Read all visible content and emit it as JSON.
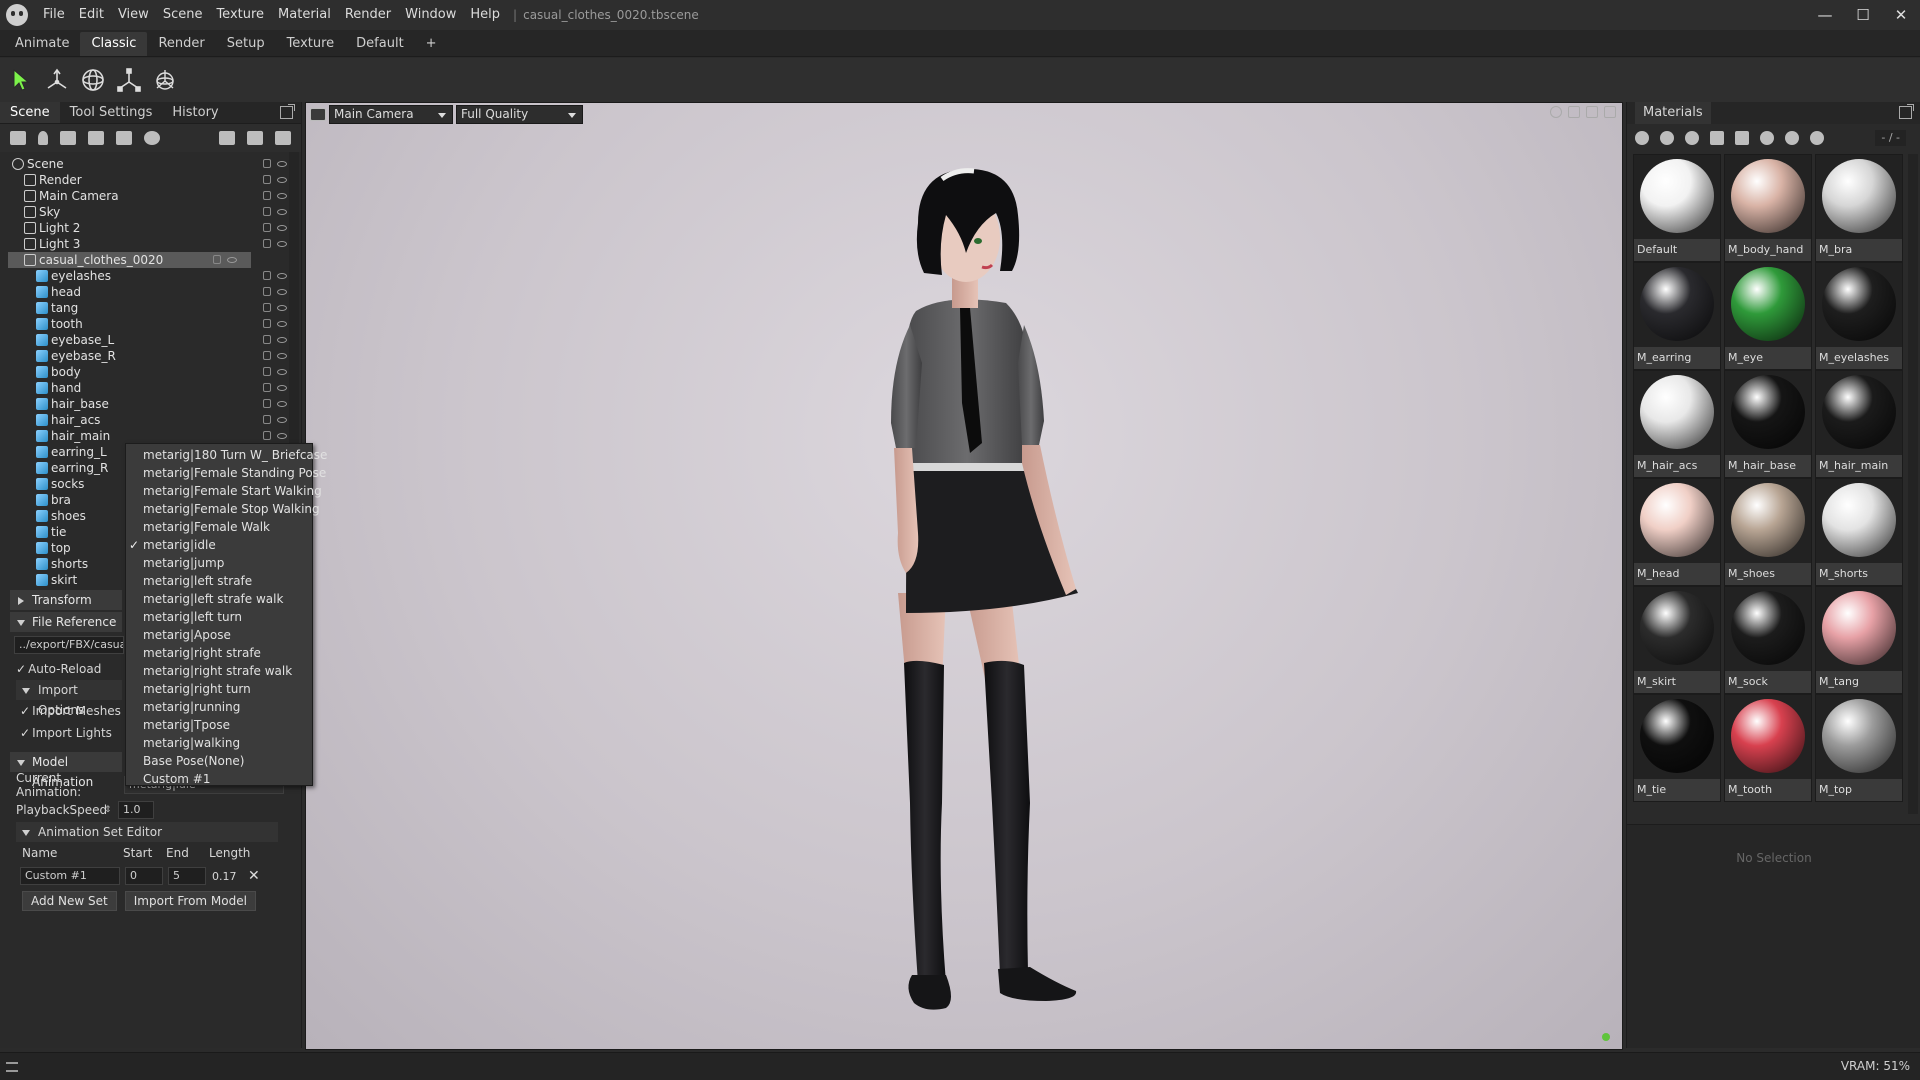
{
  "titlebar": {
    "menu": [
      "File",
      "Edit",
      "View",
      "Scene",
      "Texture",
      "Material",
      "Render",
      "Window",
      "Help"
    ],
    "document": "casual_clothes_0020.tbscene",
    "controls": [
      "—",
      "☐",
      "✕"
    ]
  },
  "workspace_tabs": [
    "Animate",
    "Classic",
    "Render",
    "Setup",
    "Texture",
    "Default",
    "+"
  ],
  "left_panel": {
    "tabs": [
      "Scene",
      "Tool Settings",
      "History"
    ],
    "tree": [
      {
        "label": "Scene",
        "level": 0
      },
      {
        "label": "Render",
        "level": 1
      },
      {
        "label": "Main Camera",
        "level": 1
      },
      {
        "label": "Sky",
        "level": 1
      },
      {
        "label": "Light 2",
        "level": 1
      },
      {
        "label": "Light 3",
        "level": 1
      },
      {
        "label": "casual_clothes_0020",
        "level": 1,
        "selected": true
      },
      {
        "label": "eyelashes",
        "level": 2
      },
      {
        "label": "head",
        "level": 2
      },
      {
        "label": "tang",
        "level": 2
      },
      {
        "label": "tooth",
        "level": 2
      },
      {
        "label": "eyebase_L",
        "level": 2
      },
      {
        "label": "eyebase_R",
        "level": 2
      },
      {
        "label": "body",
        "level": 2
      },
      {
        "label": "hand",
        "level": 2
      },
      {
        "label": "hair_base",
        "level": 2
      },
      {
        "label": "hair_acs",
        "level": 2
      },
      {
        "label": "hair_main",
        "level": 2
      },
      {
        "label": "earring_L",
        "level": 2
      },
      {
        "label": "earring_R",
        "level": 2
      },
      {
        "label": "socks",
        "level": 2
      },
      {
        "label": "bra",
        "level": 2
      },
      {
        "label": "shoes",
        "level": 2
      },
      {
        "label": "tie",
        "level": 2
      },
      {
        "label": "top",
        "level": 2
      },
      {
        "label": "shorts",
        "level": 2
      },
      {
        "label": "skirt",
        "level": 2
      }
    ],
    "transform_header": "Transform",
    "file_reference_header": "File Reference",
    "file_path": "../export/FBX/casua",
    "auto_reload": "Auto-Reload",
    "import_options_header": "Import Options",
    "import_meshes": "Import Meshes",
    "import_lights": "Import Lights",
    "model_animation_header": "Model Animation",
    "current_animation_label": "Current Animation:",
    "current_animation_value": "metarig|idle",
    "playback_speed_label": "PlaybackSpeed",
    "playback_speed_value": "1.0",
    "anim_set_editor_header": "Animation Set Editor",
    "set_columns": [
      "Name",
      "Start",
      "End",
      "Length"
    ],
    "set_row": {
      "name": "Custom #1",
      "start": "0",
      "end": "5",
      "length": "0.17"
    },
    "add_new_set": "Add New Set",
    "import_from_model": "Import From Model"
  },
  "animation_menu": {
    "items": [
      "metarig|180 Turn W_ Briefcase",
      "metarig|Female Standing Pose",
      "metarig|Female Start Walking",
      "metarig|Female Stop Walking",
      "metarig|Female Walk",
      "metarig|idle",
      "metarig|jump",
      "metarig|left strafe",
      "metarig|left strafe walk",
      "metarig|left turn",
      "metarig|Apose",
      "metarig|right strafe",
      "metarig|right strafe walk",
      "metarig|right turn",
      "metarig|running",
      "metarig|Tpose",
      "metarig|walking",
      "Base Pose(None)",
      "Custom #1"
    ],
    "checked_index": 5,
    "check_mark": "✓"
  },
  "viewport": {
    "camera": "Main Camera",
    "quality": "Full Quality"
  },
  "materials_panel": {
    "title": "Materials",
    "page_indicator": "- / -",
    "materials": [
      {
        "name": "Default",
        "color": "#f2f2f2"
      },
      {
        "name": "M_body_hand",
        "color": "#d9b3a6"
      },
      {
        "name": "M_bra",
        "color": "#d6d6d6"
      },
      {
        "name": "M_earring",
        "color": "#2a2a2e"
      },
      {
        "name": "M_eye",
        "color": "#2f9a3a"
      },
      {
        "name": "M_eyelashes",
        "color": "#1e1e1e"
      },
      {
        "name": "M_hair_acs",
        "color": "#e8e8e8"
      },
      {
        "name": "M_hair_base",
        "color": "#151515"
      },
      {
        "name": "M_hair_main",
        "color": "#1b1b1b"
      },
      {
        "name": "M_head",
        "color": "#f0cfc6"
      },
      {
        "name": "M_shoes",
        "color": "#b8a594"
      },
      {
        "name": "M_shorts",
        "color": "#e3e3e3"
      },
      {
        "name": "M_skirt",
        "color": "#2c2c2c"
      },
      {
        "name": "M_sock",
        "color": "#1c1c1c"
      },
      {
        "name": "M_tang",
        "color": "#e7a1a6"
      },
      {
        "name": "M_tie",
        "color": "#0f0f0f"
      },
      {
        "name": "M_tooth",
        "color": "#d8414f"
      },
      {
        "name": "M_top",
        "color": "#9c9c9c"
      }
    ],
    "no_selection": "No Selection"
  },
  "statusbar": {
    "vram": "VRAM: 51%"
  },
  "colors": {
    "accent_green": "#5fc43c",
    "select_cursor": "#7cf24a"
  }
}
